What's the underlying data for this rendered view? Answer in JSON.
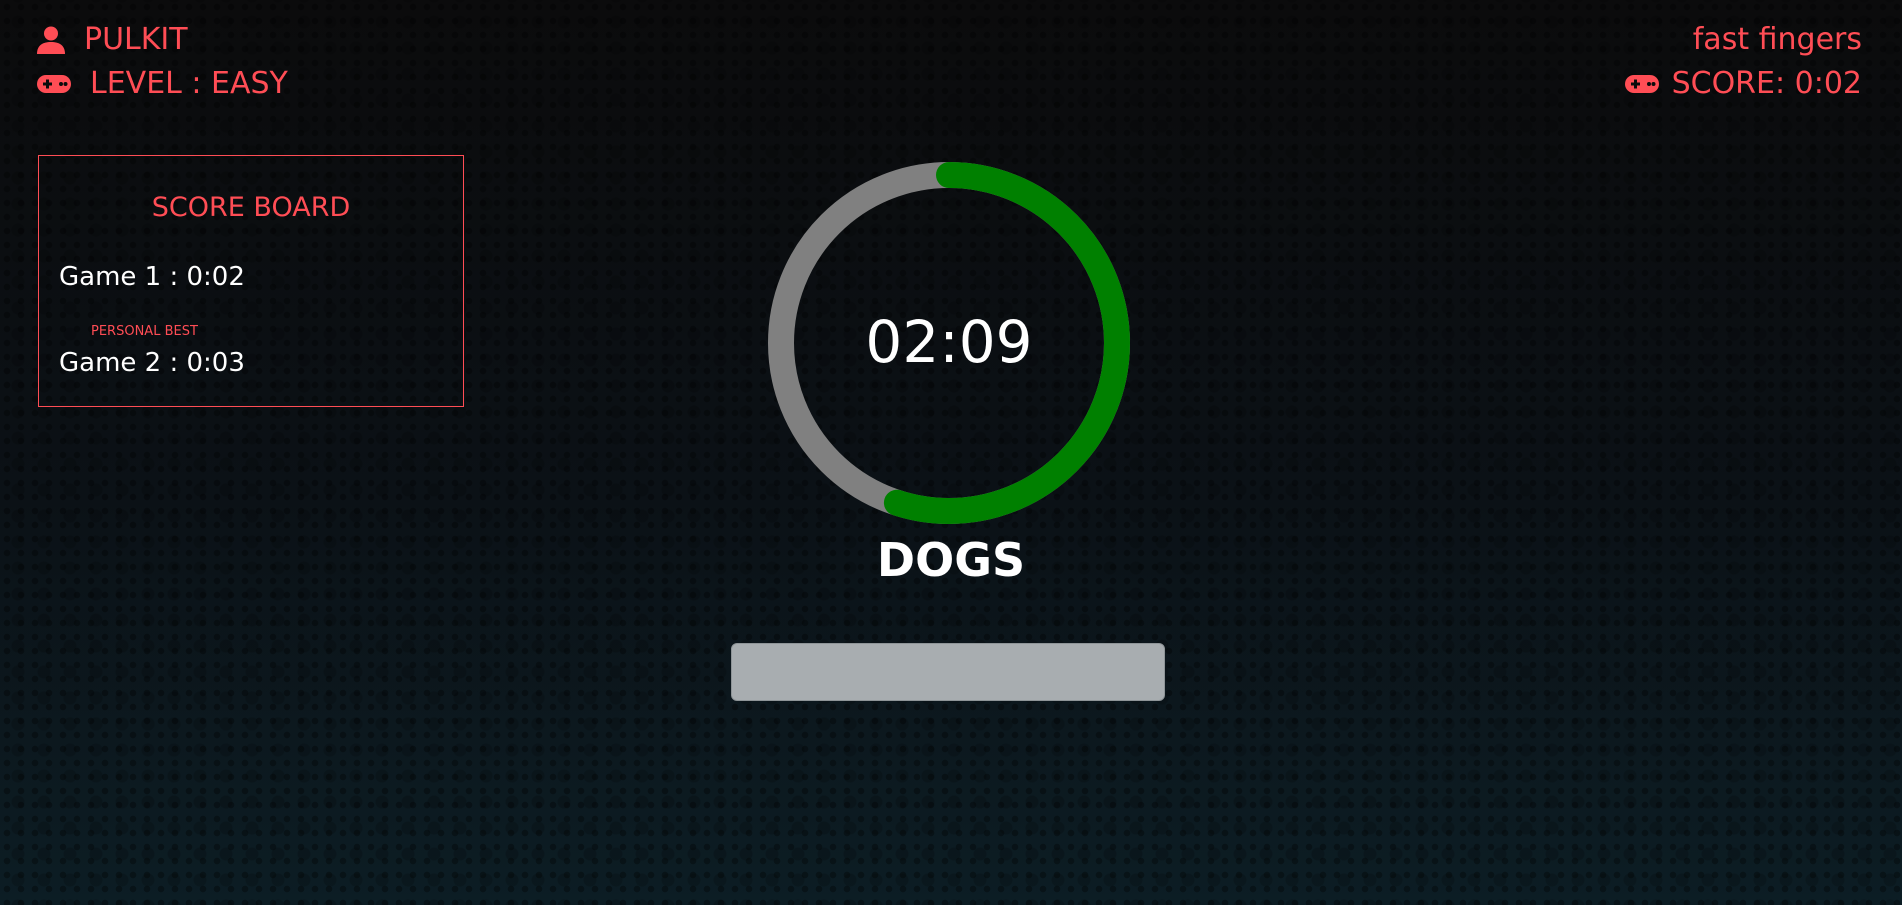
{
  "player": {
    "name": "PULKIT",
    "level_text": "LEVEL : EASY"
  },
  "game": {
    "title": "fast fingers",
    "score_text": "SCORE: 0:02"
  },
  "scoreboard": {
    "title": "SCORE BOARD",
    "games": [
      {
        "label": "Game 1 : 0:02"
      },
      {
        "label": "Game 2 : 0:03"
      }
    ],
    "personal_best_label": "PERSONAL BEST"
  },
  "timer": {
    "display": "02:09",
    "remaining_fraction": 0.55
  },
  "current_word": "DOGS",
  "input": {
    "value": "",
    "placeholder": ""
  },
  "colors": {
    "accent": "#ff4d55",
    "timer_remaining": "#008000",
    "timer_track": "#808080",
    "text": "#ffffff"
  },
  "icons": {
    "player": "user-icon",
    "level": "gamepad-icon",
    "score": "gamepad-icon"
  }
}
